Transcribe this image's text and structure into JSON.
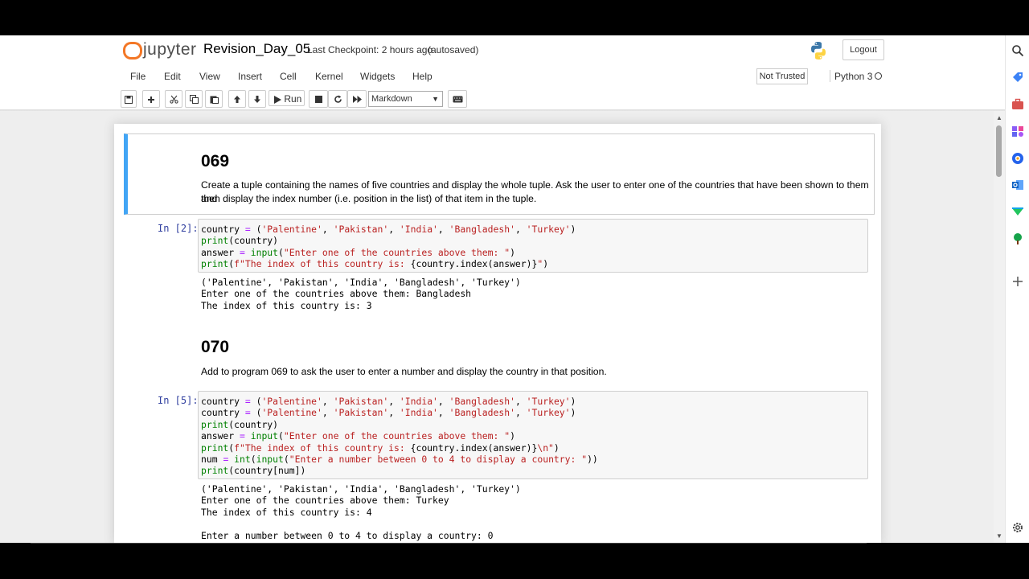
{
  "header": {
    "logo_text": "jupyter",
    "notebook_title": "Revision_Day_05",
    "checkpoint": "Last Checkpoint: 2 hours ago",
    "autosave_status": "(autosaved)",
    "logout_label": "Logout"
  },
  "menubar": {
    "items": [
      "File",
      "Edit",
      "View",
      "Insert",
      "Cell",
      "Kernel",
      "Widgets",
      "Help"
    ],
    "trust_label": "Not Trusted",
    "kernel_name": "Python 3"
  },
  "toolbar": {
    "run_label": "Run",
    "cell_type": "Markdown"
  },
  "cells": {
    "md1": {
      "heading": "069",
      "text_line1": "Create a tuple containing the names of five countries and display the whole tuple. Ask the user to enter one of the countries that have been shown to them and",
      "text_line2": "then display the index number (i.e. position in the list) of that item in the tuple."
    },
    "code1": {
      "prompt": "In [2]:",
      "output": [
        "('Palentine', 'Pakistan', 'India', 'Bangladesh', 'Turkey')",
        "Enter one of the countries above them: Bangladesh",
        "The index of this country is: 3"
      ]
    },
    "md2": {
      "heading": "070",
      "text": "Add to program 069 to ask the user to enter a number and display the country in that position."
    },
    "code2": {
      "prompt": "In [5]:",
      "output": [
        "('Palentine', 'Pakistan', 'India', 'Bangladesh', 'Turkey')",
        "Enter one of the countries above them: Turkey",
        "The index of this country is: 4",
        "",
        "Enter a number between 0 to 4 to display a country: 0"
      ]
    }
  },
  "colors": {
    "selection_bar": "#42a5f5",
    "prompt": "#303f9f",
    "jupyter_orange": "#f37726"
  }
}
